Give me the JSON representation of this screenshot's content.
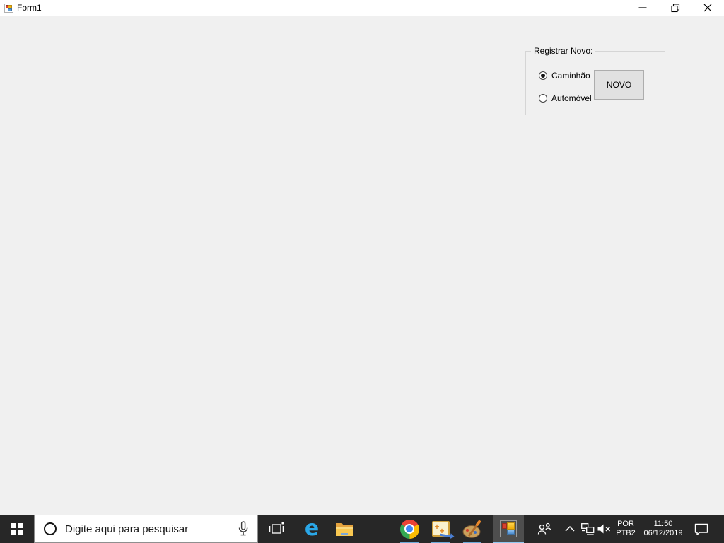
{
  "window": {
    "title": "Form1"
  },
  "form": {
    "group_title": "Registrar Novo:",
    "radios": [
      {
        "label": "Caminhão",
        "selected": true
      },
      {
        "label": "Automóvel",
        "selected": false
      }
    ],
    "button_label": "NOVO"
  },
  "taskbar": {
    "search_placeholder": "Digite aqui para pesquisar",
    "tray": {
      "language_line1": "POR",
      "language_line2": "PTB2",
      "time": "11:50",
      "date": "06/12/2019"
    }
  },
  "icons": {
    "edge_glyph": "e",
    "forms_plus": "+",
    "names": [
      "winforms-app-icon",
      "minimize-icon",
      "restore-icon",
      "close-icon",
      "radio-selected",
      "radio-unselected",
      "windows-logo-icon",
      "cortana-circle-icon",
      "microphone-icon",
      "task-view-icon",
      "edge-icon",
      "file-explorer-icon",
      "chrome-icon",
      "forms-designer-icon",
      "paint-icon",
      "people-icon",
      "chevron-up-icon",
      "network-icon",
      "volume-muted-icon",
      "action-center-icon"
    ]
  },
  "colors": {
    "titlebar_bg": "#ffffff",
    "client_bg": "#f0f0f0",
    "groupbox_border": "#d5d5d5",
    "button_bg": "#e1e1e1",
    "button_border": "#adadad",
    "taskbar_bg": "#272727",
    "active_app_bg": "#4e4e4e",
    "running_indicator": "#6ca9d8",
    "active_indicator": "#8fc7f0",
    "edge_blue": "#2aa7e8"
  }
}
